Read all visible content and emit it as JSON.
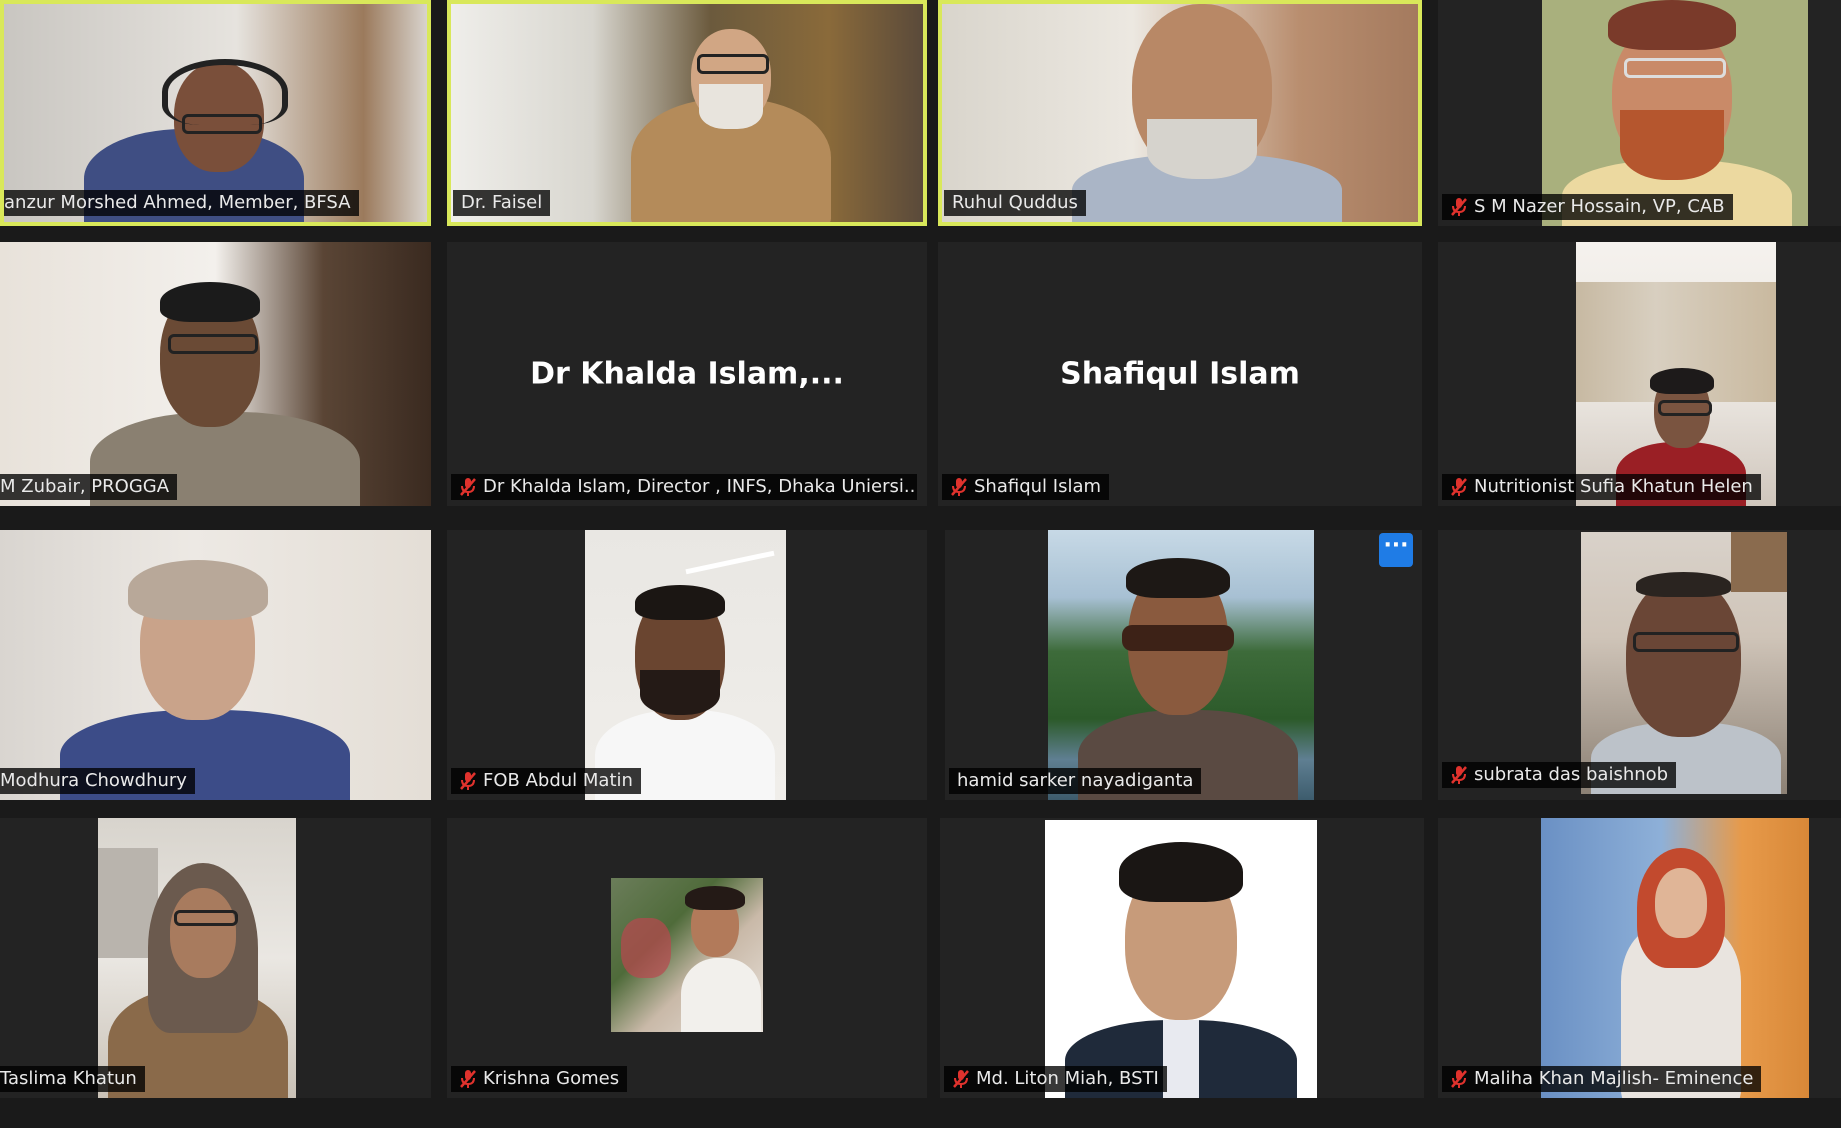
{
  "colors": {
    "background": "#1a1a1a",
    "tile_background": "#232323",
    "active_speaker_border": "#d9e85a",
    "name_tag_text": "#e9e9e9",
    "mute_icon": "#e0322d",
    "more_button": "#1f7ce6"
  },
  "participants": [
    {
      "name": "anzur Morshed Ahmed, Member, BFSA",
      "muted": false,
      "video": true,
      "speaking": true
    },
    {
      "name": "Dr. Faisel",
      "muted": false,
      "video": true,
      "speaking": true
    },
    {
      "name": "Ruhul Quddus",
      "muted": false,
      "video": true,
      "speaking": true
    },
    {
      "name": "S M Nazer Hossain, VP, CAB",
      "muted": true,
      "video": true,
      "speaking": false
    },
    {
      "name": "M Zubair, PROGGA",
      "muted": false,
      "video": true,
      "speaking": false
    },
    {
      "name": "Dr Khalda Islam, Director , INFS, Dhaka Uniersi...",
      "display_name": "Dr Khalda Islam,...",
      "muted": true,
      "video": false,
      "speaking": false
    },
    {
      "name": "Shafiqul Islam",
      "display_name": "Shafiqul Islam",
      "muted": true,
      "video": false,
      "speaking": false
    },
    {
      "name": "Nutritionist Sufia Khatun Helen",
      "muted": true,
      "video": true,
      "speaking": false
    },
    {
      "name": "Modhura Chowdhury",
      "muted": false,
      "video": true,
      "speaking": false
    },
    {
      "name": "FOB Abdul Matin",
      "muted": true,
      "video": true,
      "speaking": false
    },
    {
      "name": "hamid sarker nayadiganta",
      "muted": false,
      "video": true,
      "speaking": false,
      "more_button": "···"
    },
    {
      "name": "subrata das baishnob",
      "muted": true,
      "video": true,
      "speaking": false
    },
    {
      "name": "Taslima Khatun",
      "muted": false,
      "video": true,
      "speaking": false
    },
    {
      "name": "Krishna Gomes",
      "muted": true,
      "video": true,
      "speaking": false
    },
    {
      "name": "Md. Liton Miah, BSTI",
      "muted": true,
      "video": true,
      "speaking": false
    },
    {
      "name": "Maliha Khan Majlish- Eminence",
      "muted": true,
      "video": true,
      "speaking": false
    }
  ],
  "icons": {
    "mute": "mic-muted-icon",
    "more": "more-options-icon"
  }
}
